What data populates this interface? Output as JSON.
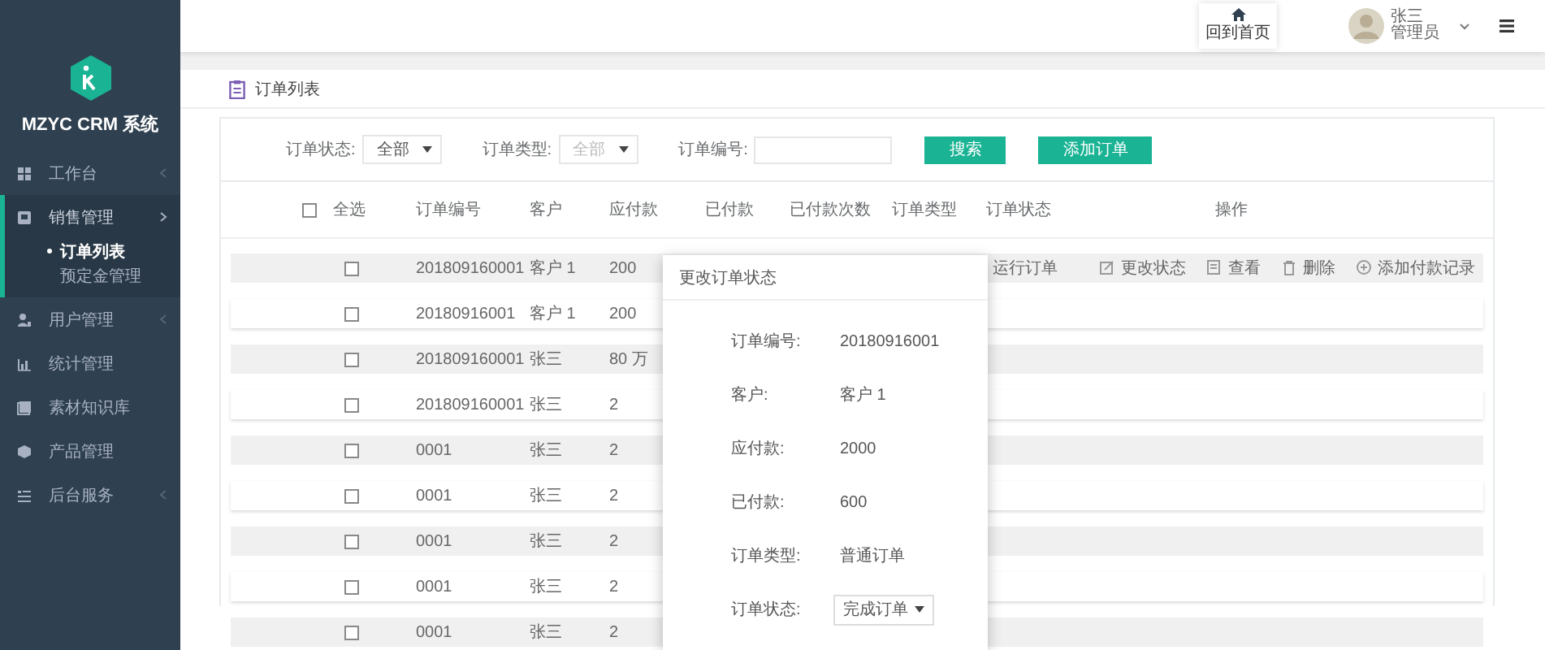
{
  "sidebar": {
    "brand": "MZYC CRM 系统",
    "items": [
      {
        "label": "工作台",
        "expanded": false,
        "selected": false
      },
      {
        "label": "销售管理",
        "expanded": true,
        "selected": true,
        "children": [
          {
            "label": "订单列表",
            "selected": true
          },
          {
            "label": "预定金管理",
            "selected": false
          }
        ]
      },
      {
        "label": "用户管理",
        "expanded": false,
        "selected": false
      },
      {
        "label": "统计管理",
        "selected": false
      },
      {
        "label": "素材知识库",
        "selected": false
      },
      {
        "label": "产品管理",
        "selected": false
      },
      {
        "label": "后台服务",
        "expanded": false,
        "selected": false
      }
    ]
  },
  "header": {
    "home_button": "回到首页",
    "user": {
      "name": "张三",
      "role": "管理员"
    }
  },
  "page_title": "订单列表",
  "filters": [
    {
      "kind": "select",
      "label": "订单状态:",
      "value": "全部",
      "disabled": false
    },
    {
      "kind": "select",
      "label": "订单类型:",
      "value": "全部",
      "disabled": true
    },
    {
      "kind": "input",
      "label": "订单编号:"
    }
  ],
  "buttons": [
    "搜索",
    "添加订单"
  ],
  "table": {
    "select_all": {
      "label": "全选",
      "checked": false
    },
    "columns": [
      "订单编号",
      "客户",
      "应付款",
      "已付款",
      "已付款次数",
      "订单类型",
      "订单状态",
      "操作"
    ],
    "rows": [
      {
        "checked": false,
        "number": "201809160001",
        "customer": "客户 1",
        "amount": "200",
        "status": "运行订单",
        "actions": [
          "更改状态",
          "查看",
          "删除",
          "添加付款记录"
        ]
      },
      {
        "checked": false,
        "number": "20180916001",
        "customer": "客户 1",
        "amount": "200"
      },
      {
        "checked": false,
        "number": "201809160001",
        "customer": "张三",
        "amount": "80 万"
      },
      {
        "checked": false,
        "number": "201809160001",
        "customer": "张三",
        "amount": "2"
      },
      {
        "checked": false,
        "number": "0001",
        "customer": "张三",
        "amount": "2"
      },
      {
        "checked": false,
        "number": "0001",
        "customer": "张三",
        "amount": "2"
      },
      {
        "checked": false,
        "number": "0001",
        "customer": "张三",
        "amount": "2"
      },
      {
        "checked": false,
        "number": "0001",
        "customer": "张三",
        "amount": "2"
      },
      {
        "checked": false,
        "number": "0001",
        "customer": "张三",
        "amount": "2"
      }
    ]
  },
  "dialog": {
    "title": "更改订单状态",
    "fields": [
      {
        "kind": "text",
        "label": "订单编号:",
        "value": "20180916001"
      },
      {
        "kind": "text",
        "label": "客户:",
        "value": "客户 1"
      },
      {
        "kind": "text",
        "label": "应付款:",
        "value": "2000"
      },
      {
        "kind": "text",
        "label": "已付款:",
        "value": "600"
      },
      {
        "kind": "text",
        "label": "订单类型:",
        "value": "普通订单"
      },
      {
        "kind": "select",
        "label": "订单状态:",
        "value": "完成订单"
      }
    ]
  }
}
